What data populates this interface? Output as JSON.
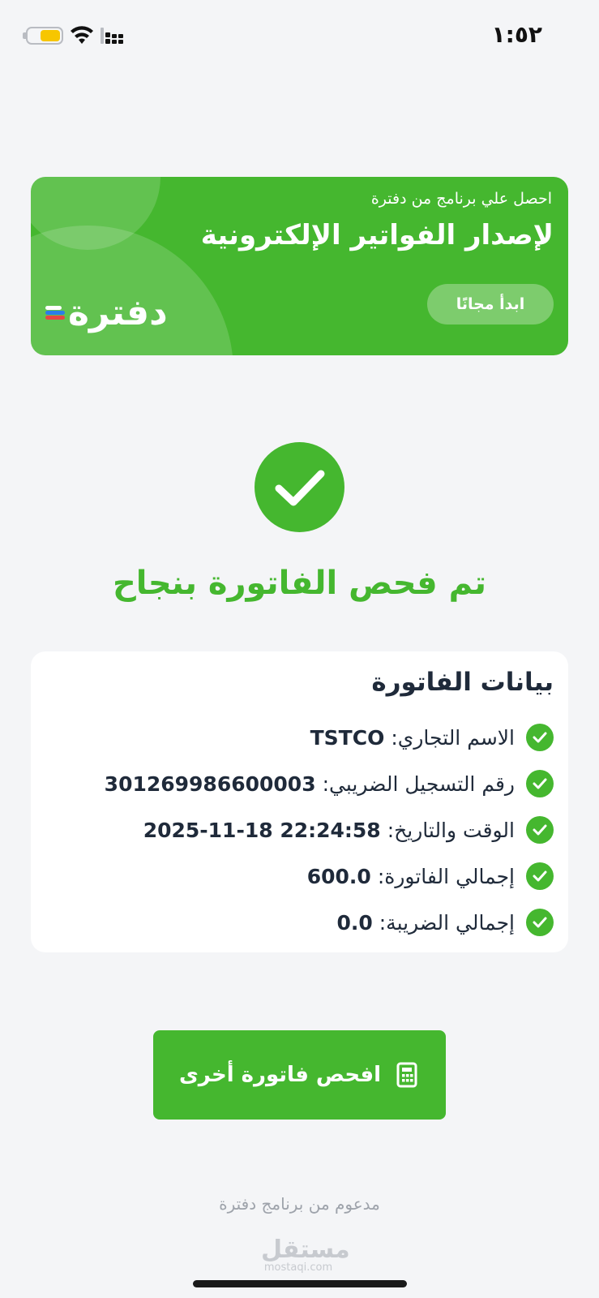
{
  "status_bar": {
    "time": "١:٥٢",
    "battery_color": "#f7c600",
    "icons": [
      "battery-icon",
      "wifi-icon",
      "cellular-signal-icon"
    ]
  },
  "banner": {
    "subtitle": "احصل علي برنامج من دفترة",
    "title": "لإصدار الفواتير الإلكترونية",
    "cta_label": "ابدأ مجانًا",
    "logo_text": "دفترة",
    "background_color": "#45b72f"
  },
  "success": {
    "icon": "check-icon",
    "title": "تم فحص الفاتورة بنجاح",
    "color": "#45b72f"
  },
  "invoice": {
    "title": "بيانات الفاتورة",
    "rows": [
      {
        "label": "الاسم التجاري:",
        "value": "TSTCO"
      },
      {
        "label": "رقم التسجيل الضريبي:",
        "value": "301269986600003"
      },
      {
        "label": "الوقت والتاريخ:",
        "value": "2025-11-18 22:24:58"
      },
      {
        "label": "إجمالي الفاتورة:",
        "value": "600.0"
      },
      {
        "label": "إجمالي الضريبة:",
        "value": "0.0"
      }
    ]
  },
  "action": {
    "label": "افحص فاتورة أخرى",
    "icon": "calculator-icon"
  },
  "footer": {
    "text": "مدعوم من برنامج دفترة"
  },
  "watermark": {
    "arabic": "مستقل",
    "latin": "mostaqi.com"
  }
}
